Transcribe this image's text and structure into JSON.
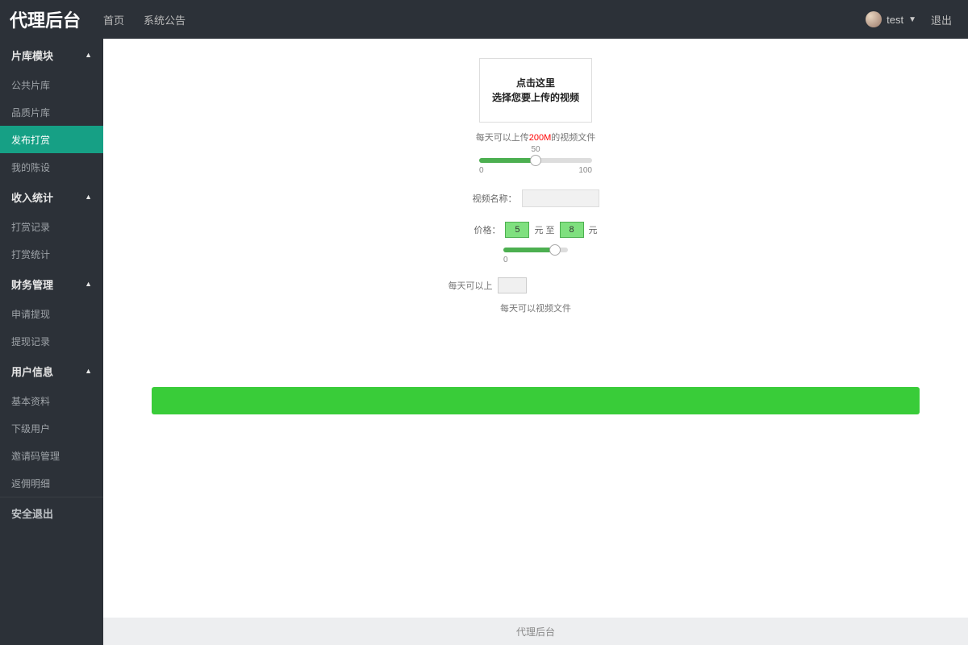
{
  "brand": "代理后台",
  "topnav": {
    "home": "首页",
    "announce": "系统公告"
  },
  "user": {
    "name": "test",
    "logout": "退出"
  },
  "sidebar": {
    "groups": [
      {
        "title": "片库模块",
        "items": [
          "公共片库",
          "品质片库",
          "发布打赏",
          "我的陈设"
        ],
        "activeIndex": 2
      },
      {
        "title": "收入统计",
        "items": [
          "打赏记录",
          "打赏统计"
        ]
      },
      {
        "title": "财务管理",
        "items": [
          "申请提现",
          "提现记录"
        ]
      },
      {
        "title": "用户信息",
        "items": [
          "基本资料",
          "下级用户",
          "邀请码管理",
          "返佣明细"
        ]
      }
    ],
    "solo": "安全退出"
  },
  "upload": {
    "line1": "点击这里",
    "line2": "选择您要上传的视频",
    "hint_prefix": "每天可以上传",
    "hint_limit": "200M",
    "hint_suffix": "的视频文件"
  },
  "slider1": {
    "value": "50",
    "min": "0",
    "max": "100",
    "percent": 50
  },
  "nameField": {
    "label": "视频名称："
  },
  "priceRow": {
    "label": "价格：",
    "val1": "5",
    "sep": "元 至",
    "val2": "8",
    "suffix": "元"
  },
  "slider2": {
    "min": "0",
    "percent": 80
  },
  "upload2": {
    "label": "每天可以上",
    "hint": "每天可以视频文件"
  },
  "footer": "代理后台"
}
